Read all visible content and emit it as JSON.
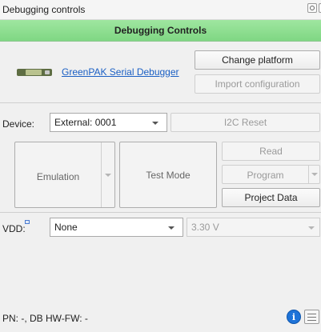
{
  "panel": {
    "title": "Debugging controls"
  },
  "header": {
    "title": "Debugging Controls",
    "color": "#8ddd90"
  },
  "debugger": {
    "device_icon": "greenpak-board-icon",
    "link_label": "GreenPAK Serial Debugger",
    "change_platform_label": "Change platform",
    "import_configuration_label": "Import configuration"
  },
  "device_row": {
    "label": "Device:",
    "selected": "External: 0001",
    "i2c_reset_label": "I2C Reset"
  },
  "actions": {
    "emulation_label": "Emulation",
    "test_mode_label": "Test Mode",
    "read_label": "Read",
    "program_label": "Program",
    "project_data_label": "Project Data"
  },
  "vdd_row": {
    "label": "VDD:",
    "selected": "None",
    "voltage_value": "3.30 V"
  },
  "status": {
    "text": "PN: -, DB HW-FW: -"
  },
  "colors": {
    "link": "#1a5fc4",
    "info_button": "#1e73d8"
  }
}
